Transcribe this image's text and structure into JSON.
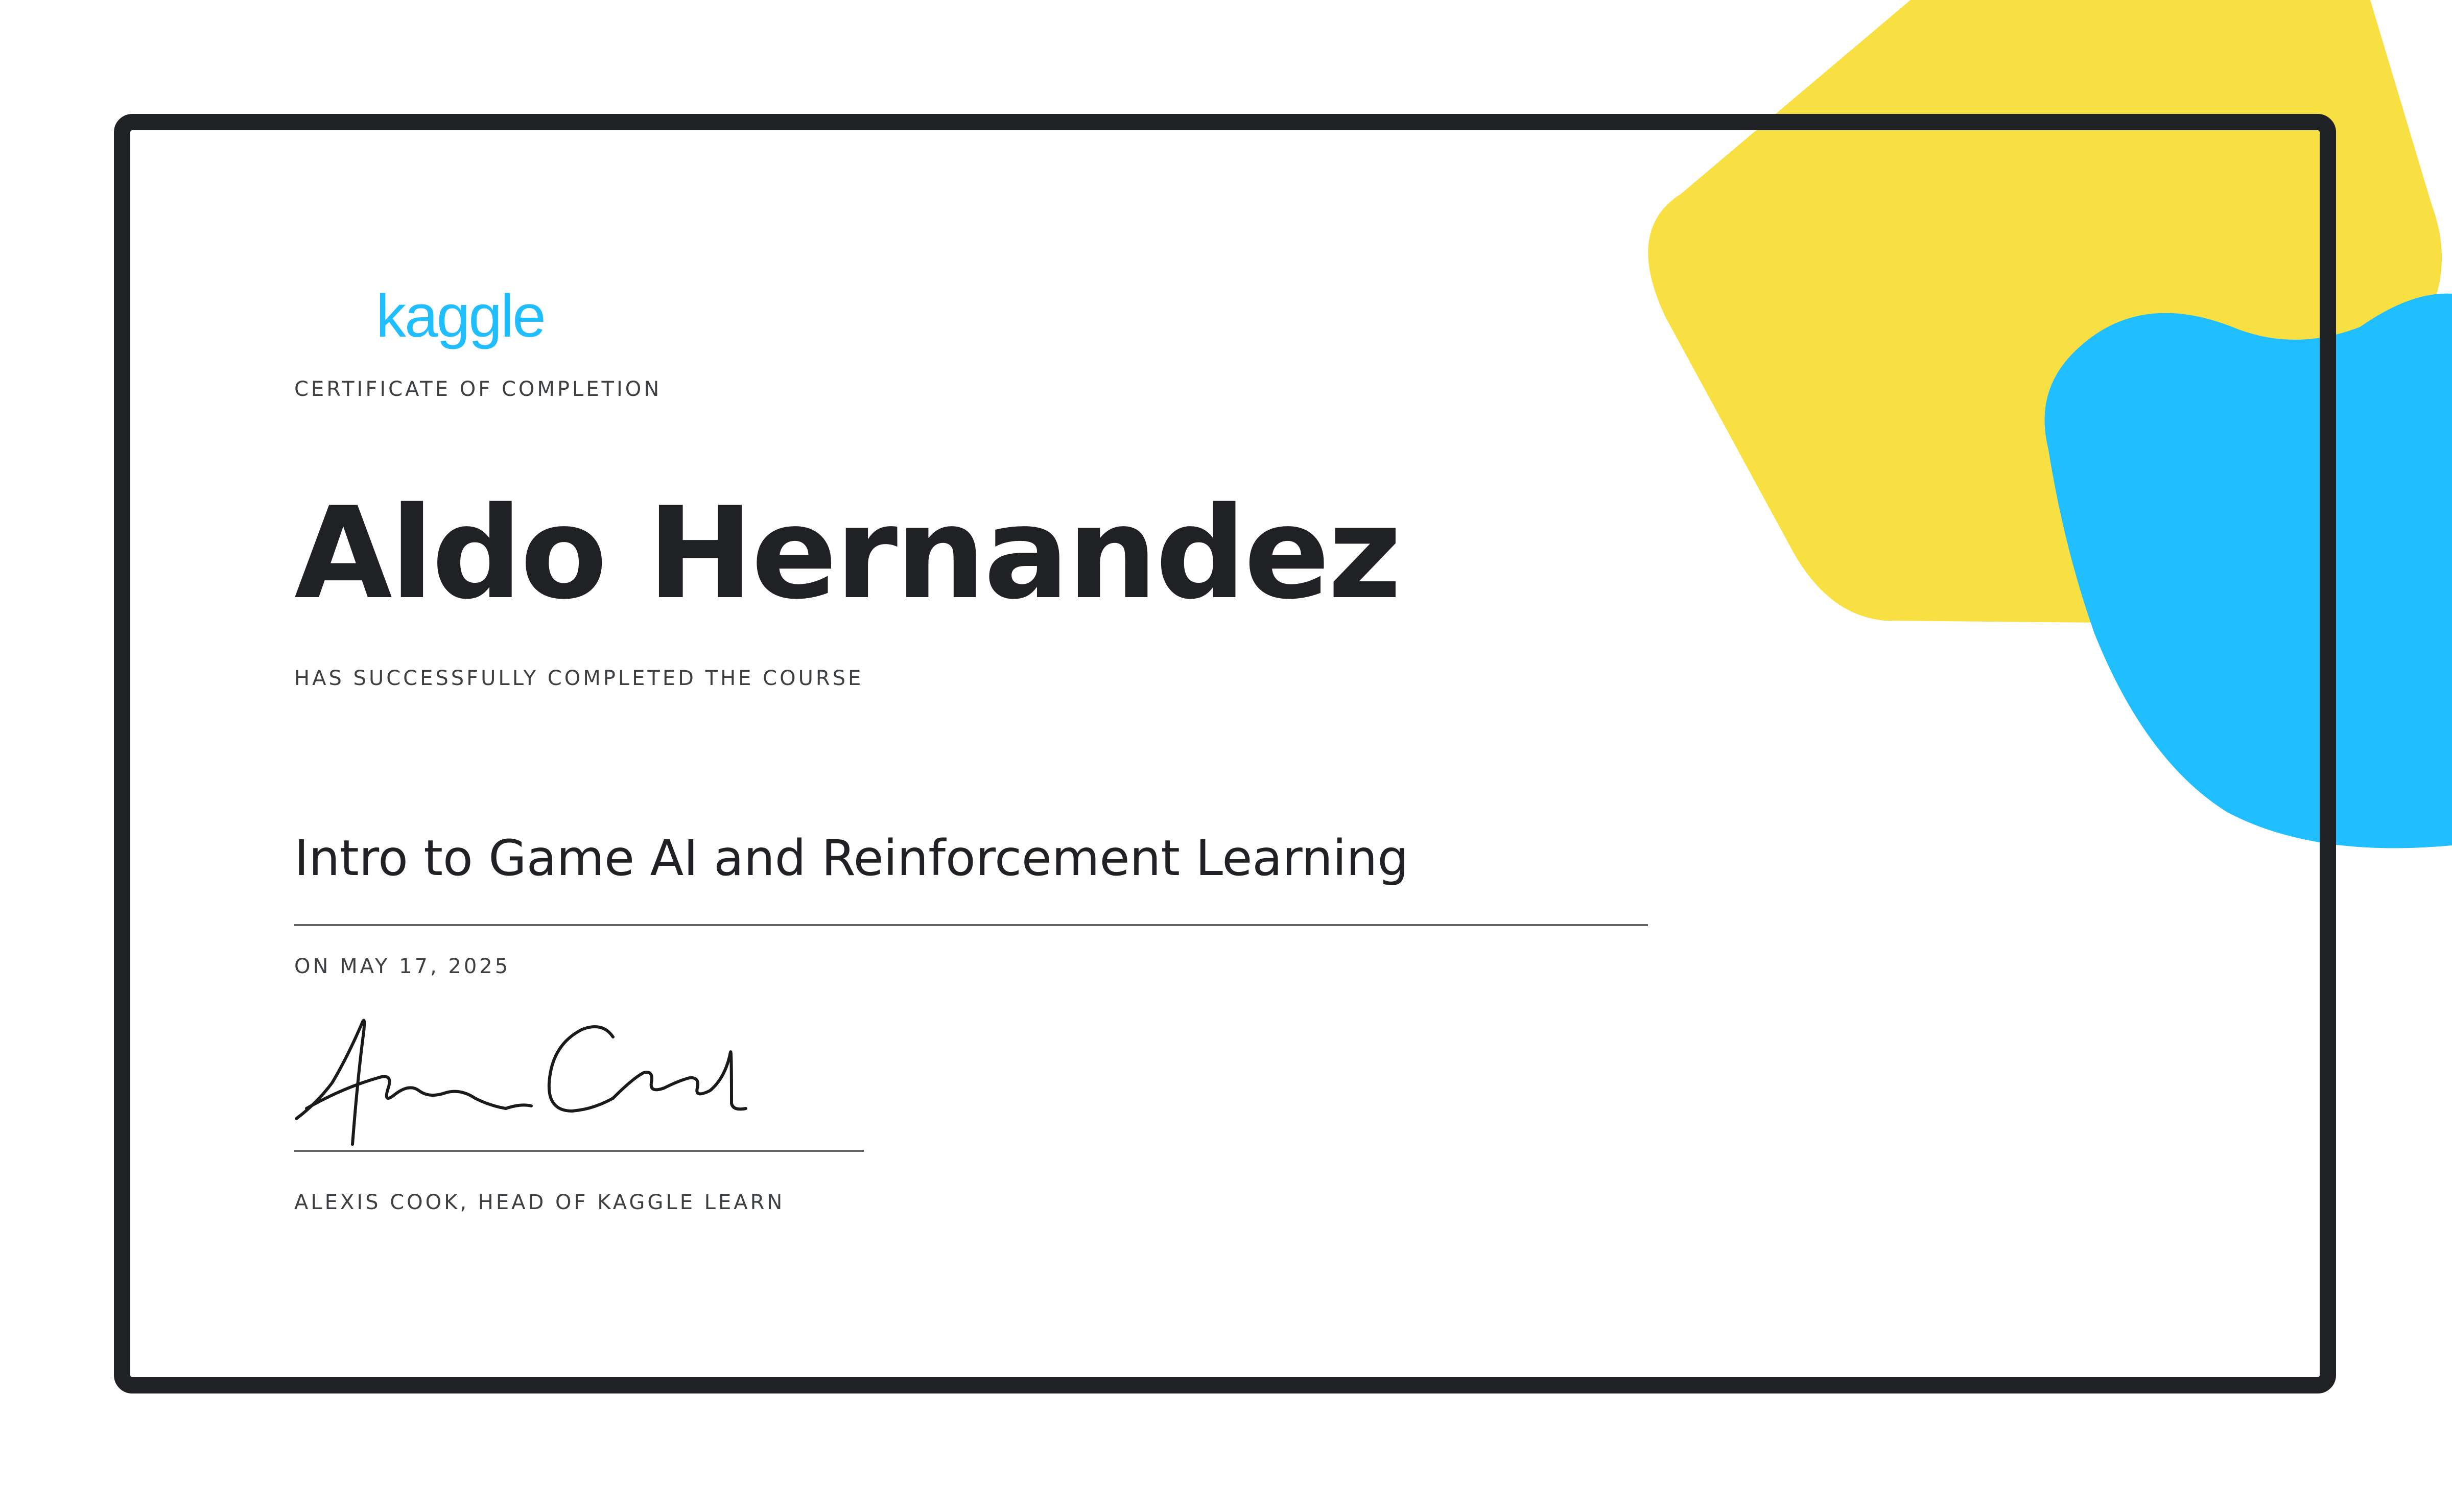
{
  "logo": {
    "text": "kaggle"
  },
  "certificate": {
    "label": "CERTIFICATE OF COMPLETION",
    "recipient_name": "Aldo Hernandez",
    "completed_label": "HAS SUCCESSFULLY COMPLETED THE COURSE",
    "course_title": "Intro to Game AI and Reinforcement Learning",
    "date_text": "ON MAY 17, 2025",
    "signer": "ALEXIS COOK, HEAD OF KAGGLE LEARN"
  },
  "colors": {
    "brand_blue": "#20beff",
    "accent_yellow": "#f8df42",
    "frame": "#202124"
  },
  "icons": [
    "kaggle-logo",
    "handwritten-signature"
  ]
}
